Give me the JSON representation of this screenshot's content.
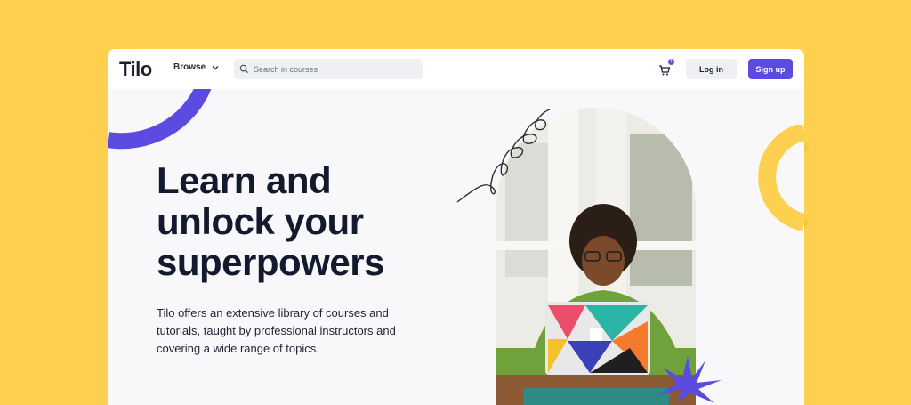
{
  "app": {
    "logo": "Tilo"
  },
  "nav": {
    "browse_label": "Browse",
    "search_placeholder": "Search in courses",
    "cart_count": "1",
    "login_label": "Log in",
    "signup_label": "Sign up"
  },
  "hero": {
    "title_line1": "Learn and",
    "title_line2": "unlock your",
    "title_line3": "superpowers",
    "description": "Tilo offers an extensive library of courses and tutorials, taught by professional instructors and covering a wide range of topics."
  },
  "colors": {
    "background": "#FDD14F",
    "accent": "#5B4BE0",
    "heading": "#141A2E"
  },
  "icons": {
    "browse_chevron": "chevron-down-icon",
    "search": "search-icon",
    "cart": "cart-icon"
  }
}
